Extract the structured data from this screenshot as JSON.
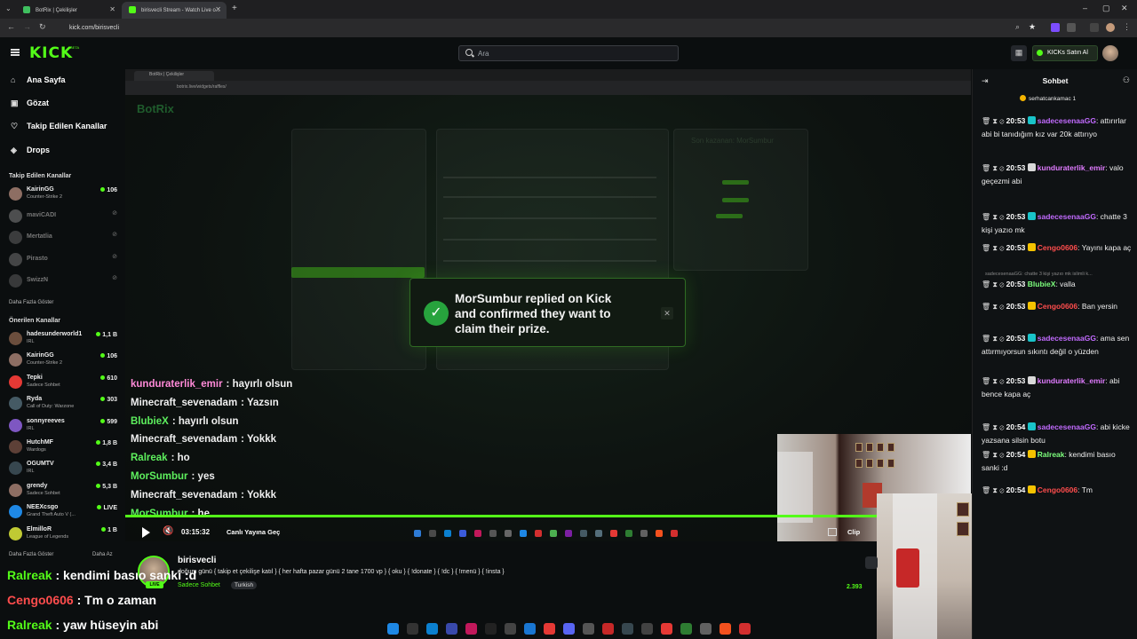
{
  "browser": {
    "tabs": [
      {
        "title": "BotRix | Çekilişler",
        "active": false
      },
      {
        "title": "birisvecli Stream - Watch Live o...",
        "active": true
      }
    ],
    "url": "kick.com/birisvecli"
  },
  "inner_browser": {
    "tab_title": "BotRix | Çekilişler",
    "url": "botrix.live/widgets/raffles/",
    "brand": "BotRix",
    "last_winner_label": "Son kazanan: MorSumbur"
  },
  "header": {
    "logo": "KICK",
    "logo_sup": "BETA",
    "search_placeholder": "Ara",
    "buy_button": "KICKs Satın Al"
  },
  "sidebar": {
    "nav": [
      {
        "label": "Ana Sayfa",
        "icon": "home-icon"
      },
      {
        "label": "Gözat",
        "icon": "compass-icon"
      },
      {
        "label": "Takip Edilen Kanallar",
        "icon": "heart-icon"
      },
      {
        "label": "Drops",
        "icon": "drop-icon"
      }
    ],
    "followed_title": "Takip Edilen Kanallar",
    "followed": [
      {
        "name": "KairinGG",
        "category": "Counter-Strike 2",
        "viewers": "106",
        "live": true,
        "color": "#8d6e63"
      },
      {
        "name": "maviCADI",
        "category": "",
        "viewers": "",
        "live": false,
        "color": "#9e9e9e"
      },
      {
        "name": "Mertatlia",
        "category": "",
        "viewers": "",
        "live": false,
        "color": "#757575"
      },
      {
        "name": "Pirasto",
        "category": "",
        "viewers": "",
        "live": false,
        "color": "#8a8a8a"
      },
      {
        "name": "SwizzN",
        "category": "",
        "viewers": "",
        "live": false,
        "color": "#6f6f6f"
      }
    ],
    "show_more": "Daha Fazla Göster",
    "recommended_title": "Önerilen Kanallar",
    "recommended": [
      {
        "name": "hadesunderworld1",
        "category": "IRL",
        "viewers": "1,1 B",
        "color": "#6b4e3d"
      },
      {
        "name": "KairinGG",
        "category": "Counter-Strike 2",
        "viewers": "106",
        "color": "#8d6e63"
      },
      {
        "name": "Tepki",
        "category": "Sadece Sohbet",
        "viewers": "610",
        "color": "#e53935"
      },
      {
        "name": "Ryda",
        "category": "Call of Duty: Warzone",
        "viewers": "303",
        "color": "#455a64"
      },
      {
        "name": "sonnyreeves",
        "category": "IRL",
        "viewers": "599",
        "color": "#7e57c2"
      },
      {
        "name": "HutchMF",
        "category": "Wardogs",
        "viewers": "1,8 B",
        "color": "#5d4037"
      },
      {
        "name": "OGUMTV",
        "category": "IRL",
        "viewers": "3,4 B",
        "color": "#37474f"
      },
      {
        "name": "grendy",
        "category": "Sadece Sohbet",
        "viewers": "5,3 B",
        "color": "#8d6e63"
      },
      {
        "name": "NEEXcsgo",
        "category": "Grand Theft Auto V (...",
        "viewers": "LIVE",
        "color": "#1e88e5"
      },
      {
        "name": "ElmilloR",
        "category": "League of Legends",
        "viewers": "1 B",
        "color": "#c0ca33"
      }
    ],
    "show_more_2": "Daha Fazla Göster",
    "show_less": "Daha Az"
  },
  "toast": {
    "message": "MorSumbur replied on Kick and confirmed they want to claim their prize."
  },
  "overlay_chat": [
    {
      "user": "kunduraterlik_emir",
      "text": ": hayırlı olsun",
      "color": "#ff8ad8"
    },
    {
      "user": "Minecraft_sevenadam",
      "text": ": Yazsın",
      "color": "#f0f0f0"
    },
    {
      "user": "BlubieX",
      "text": ": hayırlı olsun",
      "color": "#5ef05e"
    },
    {
      "user": "Minecraft_sevenadam",
      "text": ": Yokkk",
      "color": "#f0f0f0"
    },
    {
      "user": "Ralreak",
      "text": ": ho",
      "color": "#5ef05e"
    },
    {
      "user": "MorSumbur",
      "text": ": yes",
      "color": "#5ef05e"
    },
    {
      "user": "Minecraft_sevenadam",
      "text": ": Yokkk",
      "color": "#f0f0f0"
    },
    {
      "user": "MorSumbur",
      "text": ": he",
      "color": "#5ef05e"
    }
  ],
  "player": {
    "time": "03:15:32",
    "live_label": "Canlı Yayına Geç",
    "clip": "Clip"
  },
  "stream_info": {
    "name": "birisvecli",
    "title": "doğum günü { takip et çekilişe katıl } { her hafta pazar günü 2 tane 1700 vp } { oku } { !donate } { !dc } { !menü } { !insta }",
    "tag_chat": "Sadece Sohbet",
    "tag_lang": "Turkish",
    "viewers": "2.393",
    "live_badge": "LIVE"
  },
  "big_chat": [
    {
      "user": "Ralreak",
      "text": ": kendimi basıo sanki :d",
      "color": "#53fc18"
    },
    {
      "user": "Cengo0606",
      "text": ": Tm o zaman",
      "color": "#ff4d4d"
    },
    {
      "user": "Ralreak",
      "text": ": yaw hüseyin abi",
      "color": "#53fc18"
    }
  ],
  "chat": {
    "title": "Sohbet",
    "pinned_user": "serhatcankamac",
    "pinned_count": "1",
    "messages": [
      {
        "time": "20:53",
        "user": "sadecesenaaGG",
        "text": ": attırırlar abi bi tanıdığım kız var 20k attırıyo",
        "color": "#c26bff",
        "badge": "#19c3c9"
      },
      {
        "time": "20:53",
        "user": "kunduraterlik_emir",
        "text": ": valo geçezmi abi",
        "color": "#e07bff",
        "badge": "#d9d9d9"
      },
      {
        "time": "20:53",
        "user": "sadecesenaaGG",
        "text": ": chatte 3 kişi yazıo mk",
        "color": "#c26bff",
        "badge": "#19c3c9"
      },
      {
        "time": "20:53",
        "user": "Cengo0606",
        "text": ": Yayını kapa aç",
        "color": "#ff4d4d",
        "badge": "#f5c200"
      },
      {
        "time": "20:53",
        "user": "BlubieX",
        "text": ": valla",
        "color": "#7dff7d",
        "badge": ""
      },
      {
        "time": "20:53",
        "user": "Cengo0606",
        "text": ": Ban yersin",
        "color": "#ff4d4d",
        "badge": "#f5c200"
      },
      {
        "time": "20:53",
        "user": "sadecesenaaGG",
        "text": ": ama sen attırmıyorsun sıkıntı değil o yüzden",
        "color": "#c26bff",
        "badge": "#19c3c9"
      },
      {
        "time": "20:53",
        "user": "kunduraterlik_emir",
        "text": ": abi bence kapa aç",
        "color": "#e07bff",
        "badge": "#d9d9d9"
      },
      {
        "time": "20:54",
        "user": "sadecesenaaGG",
        "text": ": abi kicke yazsana silsin botu",
        "color": "#c26bff",
        "badge": "#19c3c9"
      },
      {
        "time": "20:54",
        "user": "Ralreak",
        "text": ": kendimi basıo sanki :d",
        "color": "#7dff7d",
        "badge": "#f5c200"
      },
      {
        "time": "20:54",
        "user": "Cengo0606",
        "text": ": Tm",
        "color": "#ff4d4d",
        "badge": "#f5c200"
      }
    ],
    "reply_preview": "sadecesenaaGG: chatte 3 kişi yazıo mk islimli k..."
  }
}
